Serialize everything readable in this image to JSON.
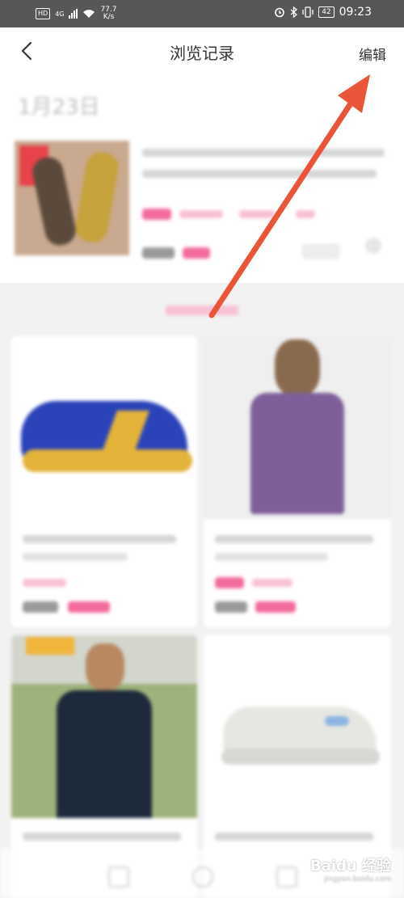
{
  "status_bar": {
    "hd": "HD",
    "network": "4G",
    "speed_value": "77.7",
    "speed_unit": "K/s",
    "battery": "42",
    "time": "09:23"
  },
  "header": {
    "title": "浏览记录",
    "edit_label": "编辑"
  },
  "history": {
    "date": "1月23日"
  },
  "watermark": {
    "brand": "Baidu 经验",
    "url": "jingyan.baidu.com"
  },
  "colors": {
    "accent": "#e8503a",
    "pink": "#f26b9c"
  }
}
